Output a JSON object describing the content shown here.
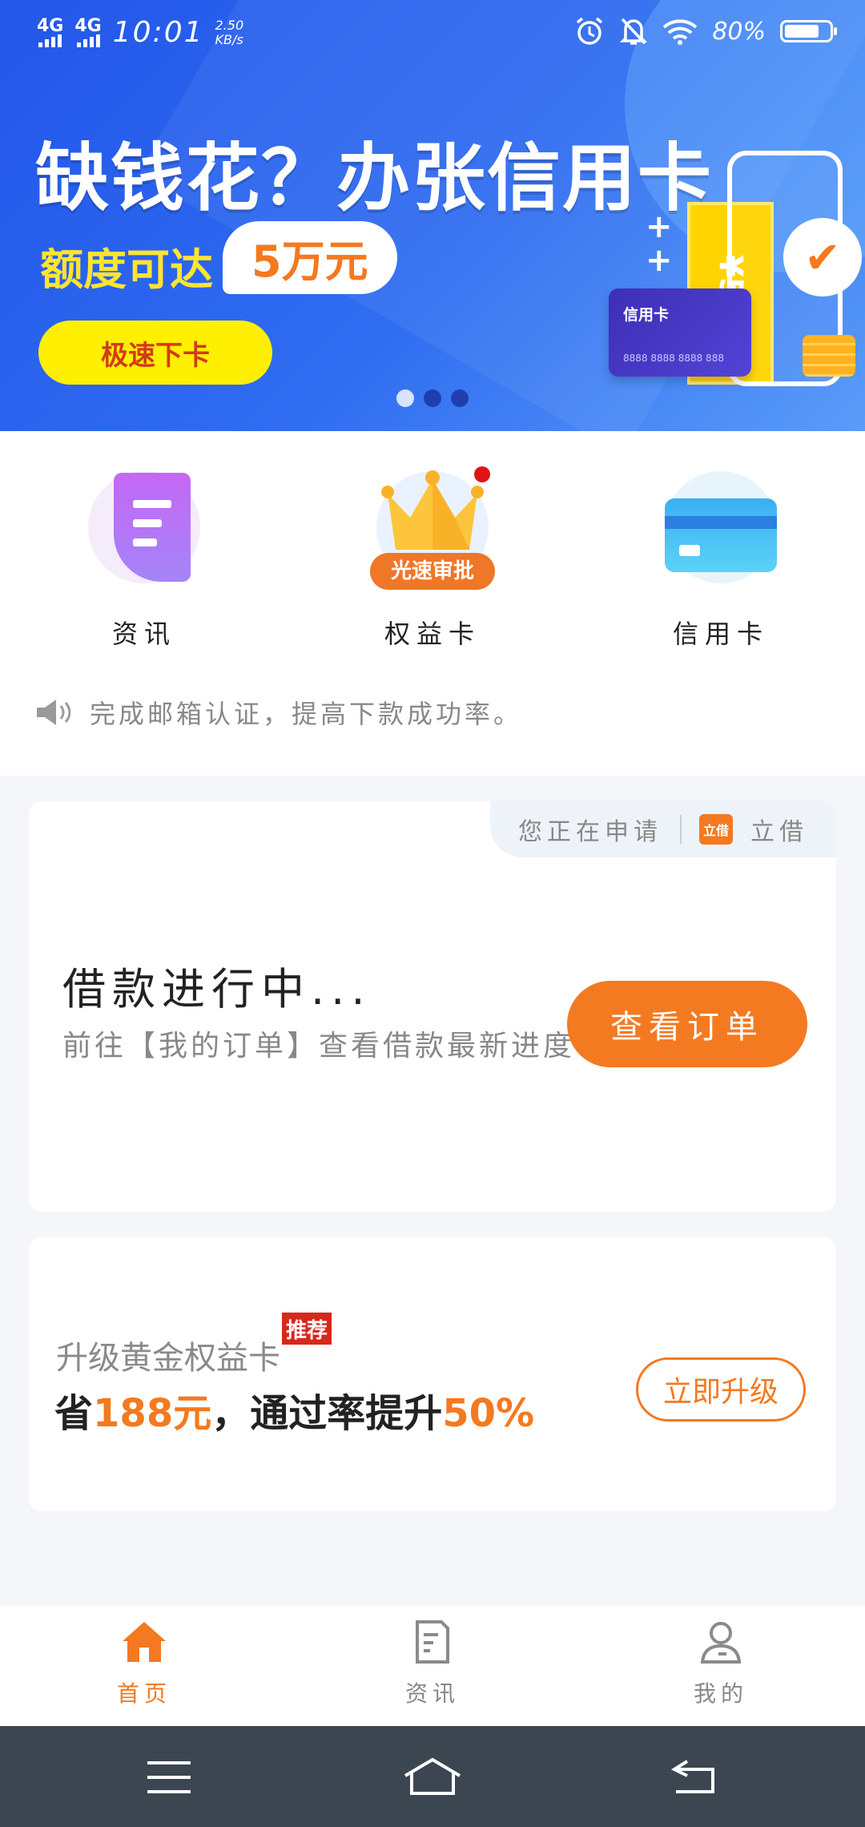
{
  "status_bar": {
    "network1": "4G",
    "network2": "4G",
    "time": "10:01",
    "speed_value": "2.50",
    "speed_unit": "KB/s",
    "battery": "80%"
  },
  "banner": {
    "title": "缺钱花？办张信用卡",
    "subtitle": "额度可达",
    "amount": "5万元",
    "button": "极速下卡",
    "ticket_text": "¥5万",
    "card_title": "信用卡",
    "card_number": "8888 8888 8888 888",
    "plus_sign": "+",
    "check_mark": "✔",
    "slide_count": 3,
    "active_slide": 1
  },
  "quick_menu": {
    "items": [
      {
        "label": "资讯",
        "icon": "document-icon"
      },
      {
        "label": "权益卡",
        "icon": "crown-icon",
        "badge": "光速审批"
      },
      {
        "label": "信用卡",
        "icon": "credit-card-icon"
      }
    ]
  },
  "notice": {
    "text": "完成邮箱认证，提高下款成功率。",
    "icon": "speaker-icon"
  },
  "loan_card": {
    "applying_label": "您正在申请",
    "product_logo": "立借",
    "product_name": "立借",
    "title": "借款进行中...",
    "subtitle": "前往【我的订单】查看借款最新进度",
    "button": "查看订单"
  },
  "upgrade_card": {
    "subtitle": "升级黄金权益卡",
    "tag": "推荐",
    "main_prefix": "省",
    "main_amount": "188元",
    "main_middle": "，通过率提升",
    "main_percent": "50%",
    "button": "立即升级"
  },
  "tabbar": {
    "tabs": [
      {
        "label": "首页",
        "icon": "home-icon",
        "active": true
      },
      {
        "label": "资讯",
        "icon": "news-icon",
        "active": false
      },
      {
        "label": "我的",
        "icon": "user-icon",
        "active": false
      }
    ]
  },
  "colors": {
    "accent": "#f47920",
    "banner_blue": "#2f6df1",
    "yellow": "#ffef00",
    "navbar": "#3b4650"
  }
}
